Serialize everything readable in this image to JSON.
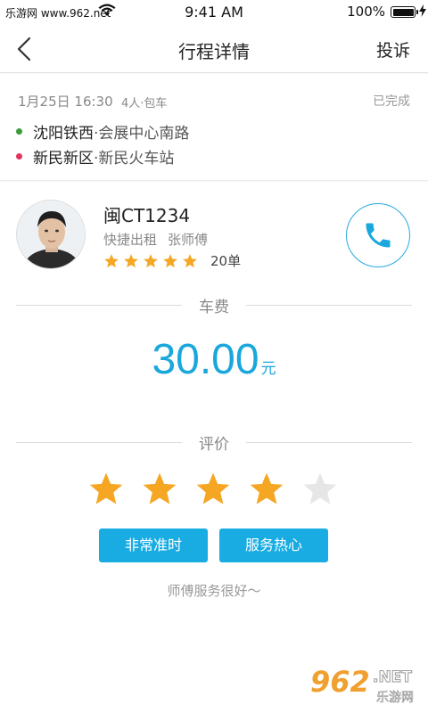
{
  "status_bar": {
    "carrier": "乐游网 www.962.net",
    "time": "9:41 AM",
    "battery": "100%"
  },
  "nav": {
    "title": "行程详情",
    "action": "投诉",
    "back_icon": "chevron-left-icon"
  },
  "trip": {
    "date": "1月25日 16:30",
    "type": "4人·包车",
    "status": "已完成",
    "route": [
      {
        "main": "沈阳铁西",
        "sub": "·会展中心南路",
        "dot_color": "#3a9a3a"
      },
      {
        "main": "新民新区",
        "sub": "·新民火车站",
        "dot_color": "#e0355a"
      }
    ]
  },
  "driver": {
    "plate": "闽CT1234",
    "company": "快捷出租",
    "name": "张师傅",
    "stars": 5,
    "orders": "20单",
    "call_icon": "phone-icon"
  },
  "fare": {
    "label": "车费",
    "amount": "30.00",
    "unit": "元"
  },
  "rating": {
    "label": "评价",
    "value": 4,
    "max": 5,
    "tags": [
      "非常准时",
      "服务热心"
    ],
    "comment": "师傅服务很好～"
  },
  "watermark": {
    "number": "962",
    "suffix": ".NET",
    "text": "乐游网"
  },
  "colors": {
    "accent": "#1aa7dc",
    "star_active": "#f5a623",
    "star_inactive": "#e6e6e6"
  }
}
